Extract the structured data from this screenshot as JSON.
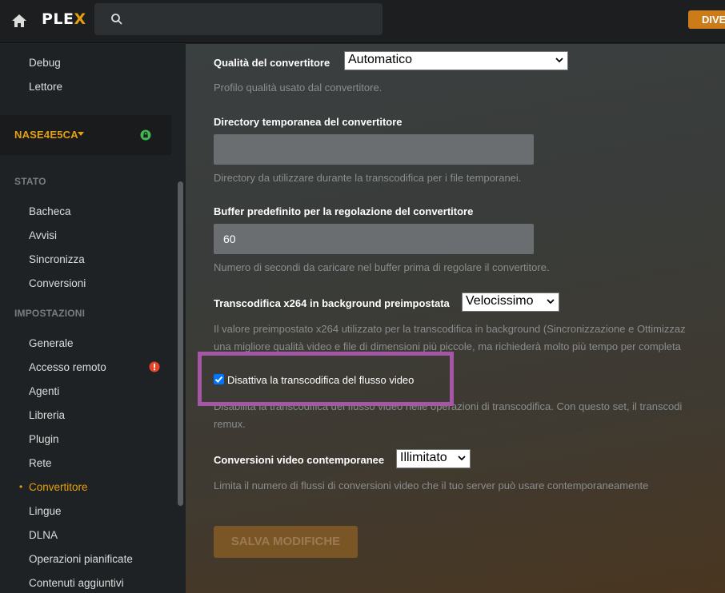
{
  "topbar": {
    "logo_main": "PLE",
    "logo_x": "X",
    "search_placeholder": "",
    "right_button_label": "DIVE"
  },
  "sidebar": {
    "top_items": [
      "Debug",
      "Lettore"
    ],
    "server": {
      "name": "NASE4E5CA"
    },
    "sections": [
      {
        "heading": "STATO",
        "items": [
          "Bacheca",
          "Avvisi",
          "Sincronizza",
          "Conversioni"
        ]
      },
      {
        "heading": "IMPOSTAZIONI",
        "items": [
          "Generale",
          "Accesso remoto",
          "Agenti",
          "Libreria",
          "Plugin",
          "Rete",
          "Convertitore",
          "Lingue",
          "DLNA",
          "Operazioni pianificate",
          "Contenuti aggiuntivi"
        ]
      }
    ],
    "active_item": "Convertitore"
  },
  "settings": {
    "quality": {
      "label": "Qualità del convertitore",
      "value": "Automatico",
      "help": "Profilo qualità usato dal convertitore."
    },
    "tempdir": {
      "label": "Directory temporanea del convertitore",
      "value": "",
      "help": "Directory da utilizzare durante la transcodifica per i file temporanei."
    },
    "buffer": {
      "label": "Buffer predefinito per la regolazione del convertitore",
      "value": "60",
      "help": "Numero di secondi da caricare nel buffer prima di regolare il convertitore."
    },
    "x264": {
      "label": "Transcodifica x264 in background preimpostata",
      "value": "Velocissimo",
      "help_line1": "Il valore preimpostato x264 utilizzato per la transcodifica in background (Sincronizzazione e Ottimizzaz",
      "help_line2": "una migliore qualità video e file di dimensioni più piccole, ma richiederà molto più tempo per completa"
    },
    "disable_video": {
      "label": "Disattiva la transcodifica del flusso video",
      "checked": true,
      "help_line1": "Disabilita la transcodifica del flusso video nelle operazioni di transcodifica. Con questo set, il transcodi",
      "help_line2": "remux."
    },
    "concurrent": {
      "label": "Conversioni video contemporanee",
      "value": "Illimitato",
      "help": "Limita il numero di flussi di conversioni video che il tuo server può usare contemporaneamente"
    },
    "save_label": "SALVA MODIFICHE"
  },
  "colors": {
    "accent": "#e5a00d",
    "highlight": "#a557a6",
    "alert": "#e5442a",
    "ok": "#3fb950"
  }
}
